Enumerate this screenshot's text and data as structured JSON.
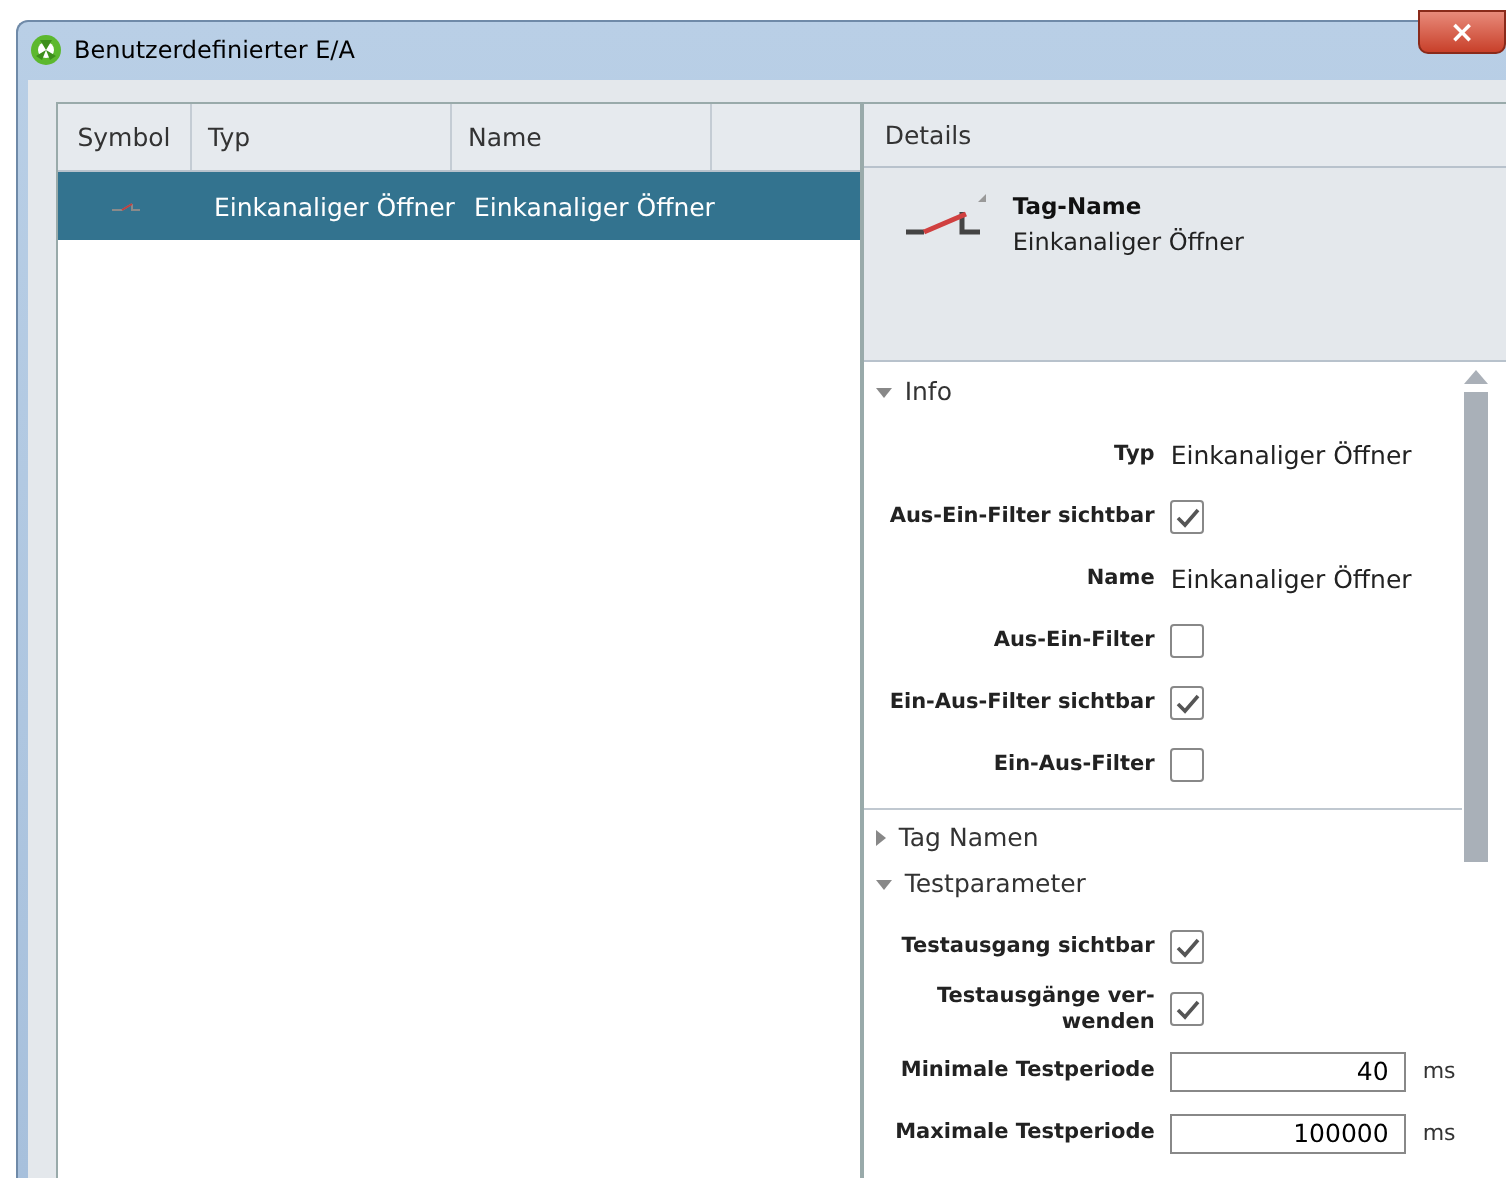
{
  "window": {
    "title": "Benutzerdefinierter E/A",
    "close": "×"
  },
  "table": {
    "columns": [
      "Symbol",
      "Typ",
      "Name"
    ],
    "rows": [
      {
        "typ": "Einkanaliger Öffner",
        "name": "Einkanaliger Öffner",
        "selected": true
      }
    ]
  },
  "details": {
    "title": "Details",
    "tag_label": "Tag-Name",
    "tag_value": "Einkanaliger Öffner",
    "sections": [
      {
        "title": "Info",
        "expanded": true,
        "rows": [
          {
            "kind": "text",
            "label": "Typ",
            "value": "Einkanaliger Öffner"
          },
          {
            "kind": "checkbox",
            "label": "Aus-Ein-Filter sichtbar",
            "checked": true
          },
          {
            "kind": "text",
            "label": "Name",
            "value": "Einkanaliger Öffner"
          },
          {
            "kind": "checkbox",
            "label": "Aus-Ein-Filter",
            "checked": false
          },
          {
            "kind": "checkbox",
            "label": "Ein-Aus-Filter sichtbar",
            "checked": true
          },
          {
            "kind": "checkbox",
            "label": "Ein-Aus-Filter",
            "checked": false
          }
        ]
      },
      {
        "title": "Tag Namen",
        "expanded": false
      },
      {
        "title": "Testparameter",
        "expanded": true,
        "rows": [
          {
            "kind": "checkbox",
            "label": "Testausgang sichtbar",
            "checked": true
          },
          {
            "kind": "checkbox",
            "label": "Testausgänge ver-\nwenden",
            "checked": true
          },
          {
            "kind": "number",
            "label": "Minimale Testperiode",
            "value": "40",
            "unit": "ms"
          },
          {
            "kind": "number",
            "label": "Maximale Testperiode",
            "value": "100000",
            "unit": "ms"
          }
        ]
      }
    ]
  }
}
